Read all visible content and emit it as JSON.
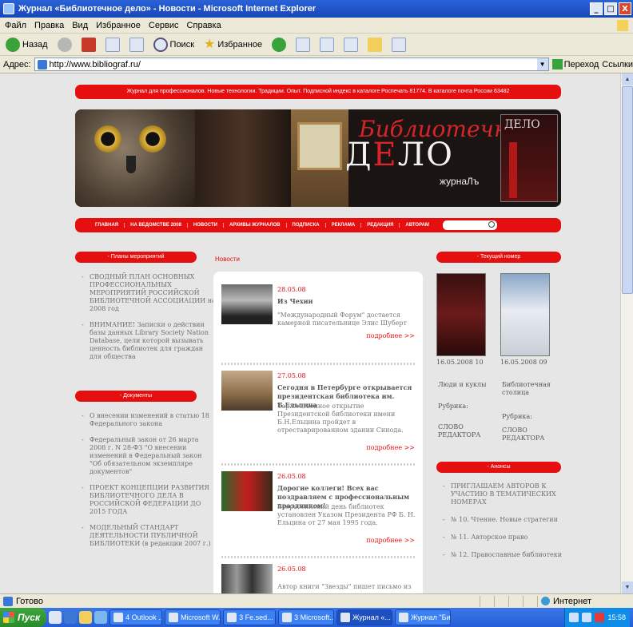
{
  "window": {
    "title": "Журнал «Библиотечное дело» - Новости - Microsoft Internet Explorer",
    "min": "_",
    "max": "□",
    "close": "X"
  },
  "menu": [
    "Файл",
    "Правка",
    "Вид",
    "Избранное",
    "Сервис",
    "Справка"
  ],
  "toolbar": {
    "back": "Назад",
    "search": "Поиск",
    "favorites": "Избранное"
  },
  "address": {
    "label": "Адрес:",
    "url": "http://www.bibliograf.ru/",
    "go": "Переход",
    "links": "Ссылки"
  },
  "site": {
    "tagline": "Журнал для профессионалов. Новые технологии. Традиции. Опыт. Подписной индекс в каталоге Роспечать 81774. В каталоге почта России 63482",
    "banner": {
      "title1": "Библиотечное",
      "title2_pre": "Д",
      "title2_red": "Е",
      "title2_post": "ЛО",
      "subtitle": "журнаЛъ",
      "cover_title": "ДЕЛО"
    },
    "nav": [
      "ГЛАВНАЯ",
      "НА ВЕДОМСТВЕ 2008",
      "НОВОСТИ",
      "АРХИВЫ ЖУРНАЛОВ",
      "ПОДПИСКА",
      "РЕКЛАМА",
      "РЕДАКЦИЯ",
      "АВТОРАМ"
    ],
    "left": {
      "plans_header": "- Планы мероприятий",
      "plans": [
        "СВОДНЫЙ ПЛАН ОСНОВНЫХ ПРОФЕССИОНАЛЬНЫХ МЕРОПРИЯТИЙ РОССИЙСКОЙ БИБЛИОТЕЧНОЙ АССОЦИАЦИИ на 2008 год",
        "ВНИМАНИЕ! Записки о действии базы данных Library Society Nation Database, цели которой вызывать ценность библиотек для граждан для общества"
      ],
      "docs_header": "- Документы",
      "docs": [
        "О внесении изменений в статью 18 Федерального закона",
        "Федеральный закон от 26 марта 2008 г. N 28-ФЗ \"О внесении изменений в Федеральный закон \"Об обязательном экземпляре документов\"",
        "ПРОЕКТ КОНЦЕПЦИИ РАЗВИТИЯ БИБЛИОТЕЧНОГО ДЕЛА В РОССИЙСКОЙ ФЕДЕРАЦИИ ДО 2015 ГОДА",
        "МОДЕЛЬНЫЙ СТАНДАРТ ДЕЯТЕЛЬНОСТИ ПУБЛИЧНОЙ БИБЛИОТЕКИ (в редакции 2007 г.)"
      ]
    },
    "breadcrumb": "Новости",
    "news": [
      {
        "date": "28.05.08",
        "title": "Из Чехии",
        "text": "\"Международный Форум\" достается камерной писательнице Элис Шуберт",
        "more": "подробнее >>"
      },
      {
        "date": "27.05.08",
        "title": "Сегодня в Петербурге открывается президентская библиотека им. Б.Ельцина",
        "text": "Торжественное открытие Президентской библиотеки имени Б.Н.Ельцина пройдет в отреставрированном здании Синода.",
        "more": "подробнее >>"
      },
      {
        "date": "26.05.08",
        "title": "Дорогие коллеги! Всех вас поздравляем с профессиональным праздником!",
        "text": "Всероссийский день библиотек установлен Указом Президента РФ Б. Н. Ельцина от 27 мая 1995 года.",
        "more": "подробнее >>"
      },
      {
        "date": "26.05.08",
        "title": "",
        "text": "Автор книги \"Звезды\" пишет письмо из",
        "more": ""
      }
    ],
    "right": {
      "issue_header": "- Текущий номер",
      "issues": [
        {
          "date": "16.05.2008 10",
          "title": "Люди и куклы",
          "rubric_label": "Рубрика:",
          "rubric": "СЛОВО РЕДАКТОРА"
        },
        {
          "date": "16.05.2008 09",
          "title": "Библиотечная столица",
          "rubric_label": "Рубрика:",
          "rubric": "СЛОВО РЕДАКТОРА"
        }
      ],
      "announce_header": "- Анонсы",
      "announce": [
        "ПРИГЛАШАЕМ АВТОРОВ К УЧАСТИЮ В ТЕМАТИЧЕСКИХ НОМЕРАХ",
        "№ 10. Чтение. Новые стратегии",
        "№ 11. Авторское право",
        "№ 12. Православные библиотеки"
      ]
    }
  },
  "status": {
    "text": "Готово",
    "zone": "Интернет"
  },
  "taskbar": {
    "start": "Пуск",
    "tasks": [
      "4 Outlook ...",
      "Microsoft W...",
      "3 Fe.sed...",
      "3 Microsoft...",
      "Журнал «...",
      "Журнал \"Би..."
    ],
    "clock": "15:58"
  },
  "colors": {
    "accent_red": "#e60f0f",
    "xp_blue": "#245ed8",
    "page_bg": "#e6e6e6"
  }
}
